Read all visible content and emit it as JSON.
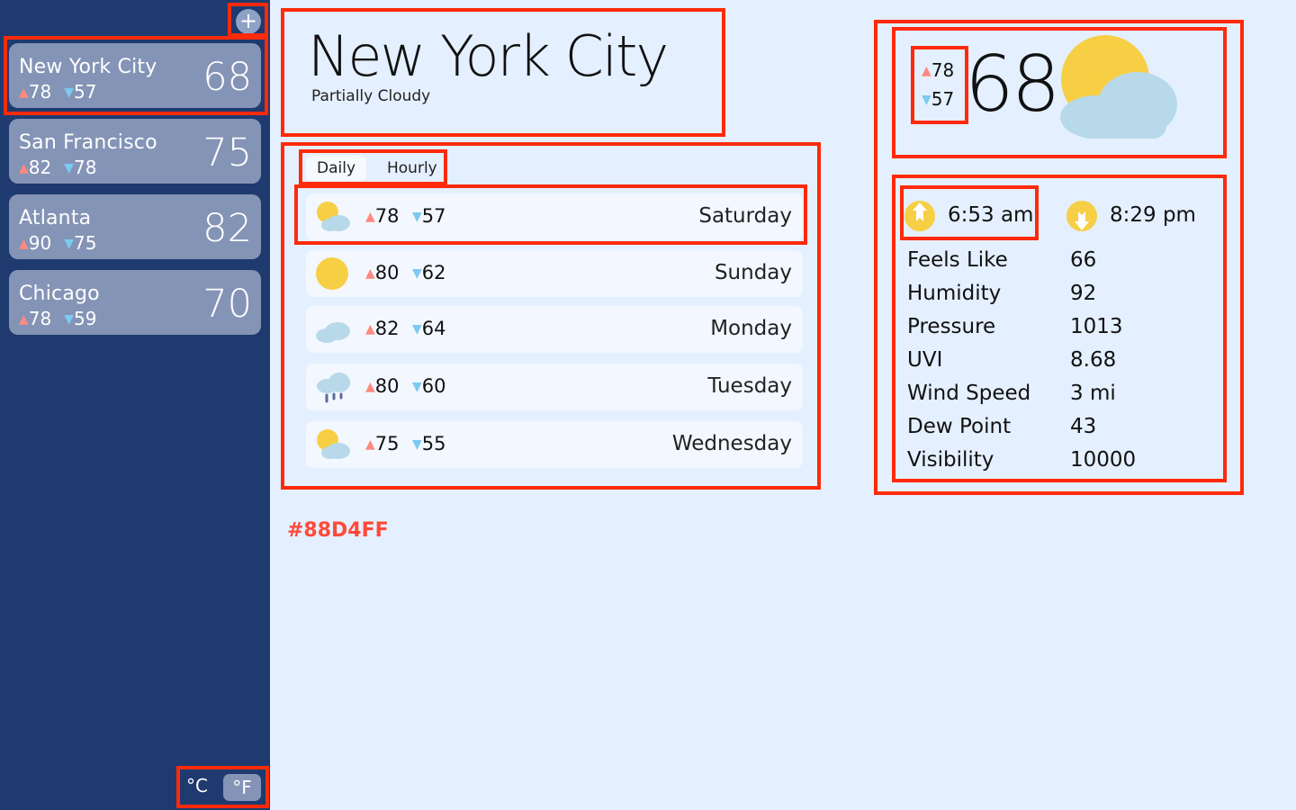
{
  "sidebar": {
    "add_symbol": "+",
    "cities": [
      {
        "name": "New York City",
        "high": "78",
        "low": "57",
        "temp": "68"
      },
      {
        "name": "San Francisco",
        "high": "82",
        "low": "78",
        "temp": "75"
      },
      {
        "name": "Atlanta",
        "high": "90",
        "low": "75",
        "temp": "82"
      },
      {
        "name": "Chicago",
        "high": "78",
        "low": "59",
        "temp": "70"
      }
    ],
    "units": {
      "celsius": "°C",
      "fahrenheit": "°F"
    }
  },
  "header": {
    "city": "New York City",
    "condition": "Partially Cloudy"
  },
  "tabs": {
    "daily": "Daily",
    "hourly": "Hourly"
  },
  "forecast": [
    {
      "icon": "partly-cloudy-icon",
      "high": "78",
      "low": "57",
      "day": "Saturday"
    },
    {
      "icon": "sun-icon",
      "high": "80",
      "low": "62",
      "day": "Sunday"
    },
    {
      "icon": "cloud-icon",
      "high": "82",
      "low": "64",
      "day": "Monday"
    },
    {
      "icon": "rain-icon",
      "high": "80",
      "low": "60",
      "day": "Tuesday"
    },
    {
      "icon": "partly-cloudy-icon",
      "high": "75",
      "low": "55",
      "day": "Wednesday"
    }
  ],
  "annotation_color_label": "#88D4FF",
  "current": {
    "high": "78",
    "low": "57",
    "temp": "68",
    "icon": "partly-cloudy-icon"
  },
  "sun": {
    "sunrise": "6:53 am",
    "sunset": "8:29 pm"
  },
  "details": [
    {
      "label": "Feels Like",
      "value": "66"
    },
    {
      "label": "Humidity",
      "value": "92"
    },
    {
      "label": "Pressure",
      "value": "1013"
    },
    {
      "label": "UVI",
      "value": "8.68"
    },
    {
      "label": "Wind Speed",
      "value": "3 mi"
    },
    {
      "label": "Dew Point",
      "value": "43"
    },
    {
      "label": "Visibility",
      "value": "10000"
    }
  ],
  "colors": {
    "sidebar_bg": "#1e3a6e",
    "card_bg": "#8494b6",
    "page_bg": "#e4efff",
    "sun": "#f7cf45",
    "cloud": "#b8d9ea",
    "high_arrow": "#ff8a80",
    "low_arrow": "#7cc9f2",
    "annotation_box": "#ff2a0a"
  }
}
